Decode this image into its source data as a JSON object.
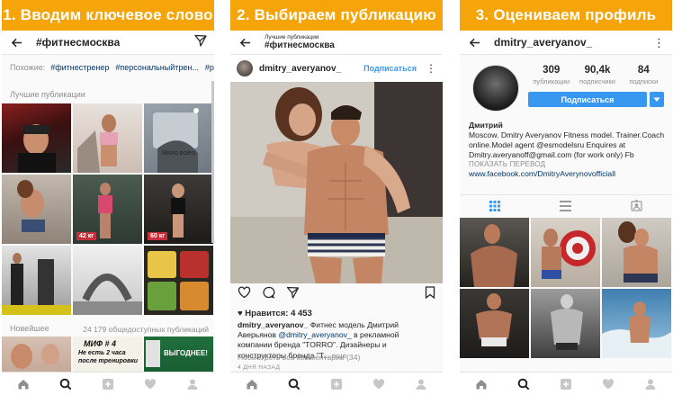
{
  "panels": [
    {
      "banner": "1. Вводим ключевое слово",
      "title": "#фитнесмосква",
      "related_label": "Похожие:",
      "related_tags": [
        "#фитнестренер",
        "#персональныйтрен...",
        "#рабо"
      ],
      "top_label": "Лучшие публикации",
      "recent_label": "Новейшее",
      "recent_count": "24 179 общедоступных публикаций",
      "tile_captions": [
        "42 кг",
        "60 кг",
        "МИФ # 4",
        "Не есть 2 часа",
        "после тренировки",
        "ВЫГОДНЕЕ!"
      ]
    },
    {
      "banner": "2. Выбираем публикацию",
      "subtitle_small": "Лучшие публикации",
      "subtitle_big": "#фитнесмосква",
      "user": "dmitry_averyanov_",
      "follow": "Подписаться",
      "likes": "♥ Нравится: 4 453",
      "caption_user": "dmitry_averyanov_",
      "caption_text": " Фитнес модель Дмитрий Аверьянов",
      "caption_mention": "@dmitry_averyanov_",
      "caption_text2": " в рекламной компании бренда \"TORRO\". Дизайнеры и конструкторы бренда \"Т...",
      "caption_more": " еще",
      "comments": "Посмотреть все комментарии (34)",
      "ago": "4 ДНЯ НАЗАД"
    },
    {
      "banner": "3. Оцениваем профиль",
      "title": "dmitry_averyanov_",
      "stats": [
        {
          "num": "309",
          "label": "публикации"
        },
        {
          "num": "90,4k",
          "label": "подписчики"
        },
        {
          "num": "84",
          "label": "подписки"
        }
      ],
      "follow": "Подписаться",
      "bio_name": "Дмитрий",
      "bio_text": "Moscow. Dmitry Averyanov Fitness model. Trainer.Coach online.Model agent @esmodelsru Enquires at Dmitry.averyanoff@gmail.com (for work only) Fb",
      "bio_translate": "ПОКАЗАТЬ ПЕРЕВОД",
      "bio_link": "www.facebook.com/DmitryAverynovofficiall"
    }
  ],
  "colors": {
    "banner": "#f5a50a",
    "link": "#003569",
    "accent": "#3897f0"
  },
  "icons": {
    "back": "arrow-left-icon",
    "send": "send-icon",
    "home": "home-icon",
    "search": "search-icon",
    "add": "add-icon",
    "heart": "heart-icon",
    "profile": "profile-icon"
  }
}
